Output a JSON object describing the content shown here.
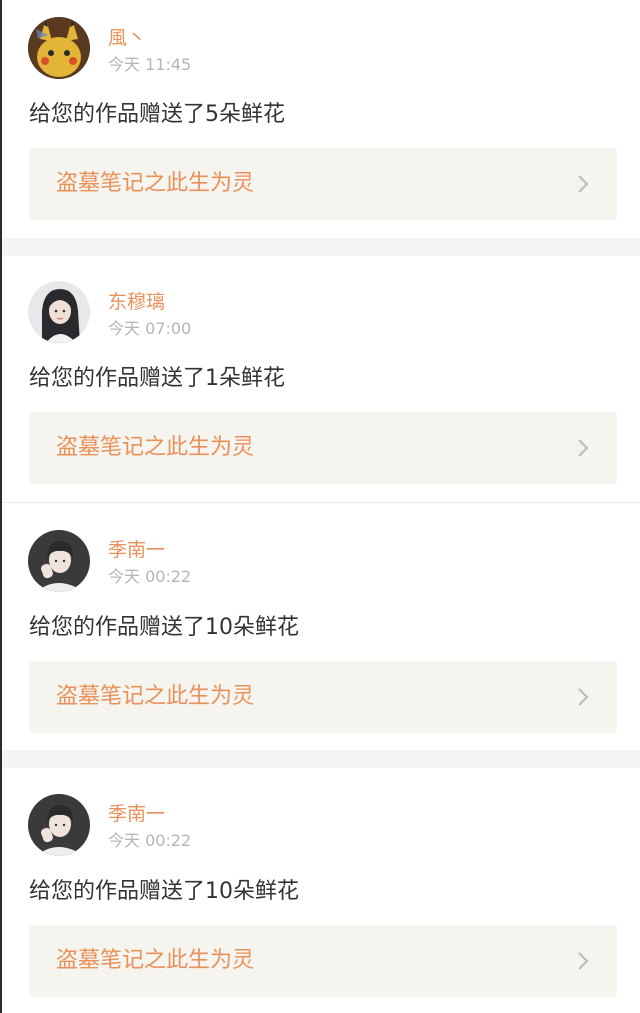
{
  "notifications": [
    {
      "username": "風丶",
      "time": "今天 11:45",
      "message": "给您的作品赠送了5朵鲜花",
      "work_title": "盗墓笔记之此生为灵",
      "avatar_icon": "pikachu-avatar"
    },
    {
      "username": "东穆璃",
      "time": "今天 07:00",
      "message": "给您的作品赠送了1朵鲜花",
      "work_title": "盗墓笔记之此生为灵",
      "avatar_icon": "girl-portrait-avatar"
    },
    {
      "username": "季南一",
      "time": "今天 00:22",
      "message": "给您的作品赠送了10朵鲜花",
      "work_title": "盗墓笔记之此生为灵",
      "avatar_icon": "boy-portrait-avatar"
    },
    {
      "username": "季南一",
      "time": "今天 00:22",
      "message": "给您的作品赠送了10朵鲜花",
      "work_title": "盗墓笔记之此生为灵",
      "avatar_icon": "boy-portrait-avatar"
    }
  ],
  "colors": {
    "accent": "#e9915a",
    "time": "#b5b5b5",
    "text": "#333333",
    "card_bg": "#f5f4ee",
    "separator": "#f5f5f5"
  }
}
